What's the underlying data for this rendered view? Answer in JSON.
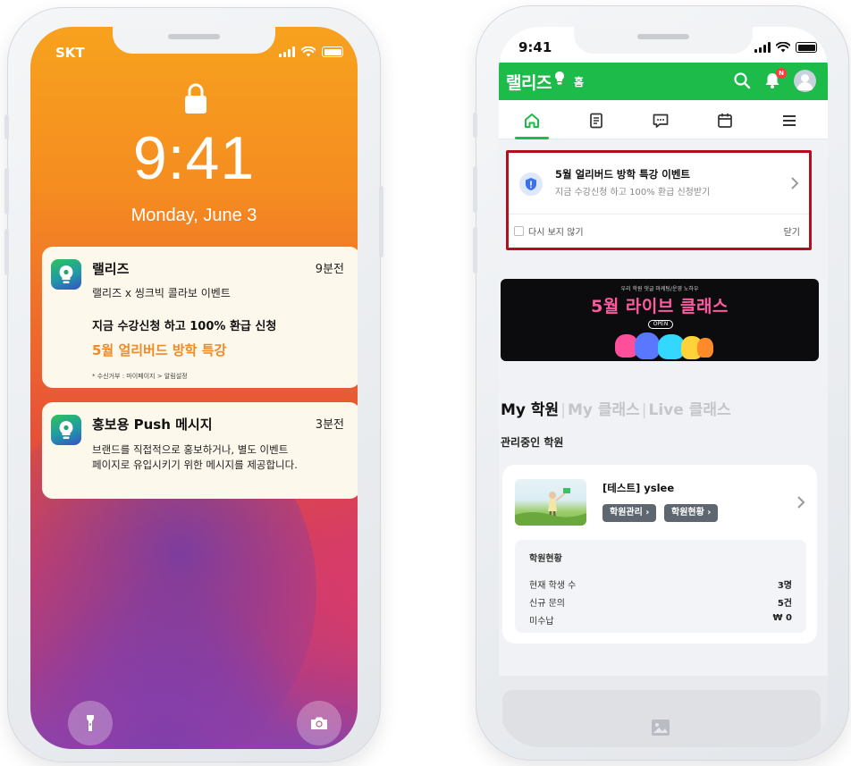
{
  "lock_screen": {
    "carrier": "SKT",
    "time": "9:41",
    "date": "Monday, June 3",
    "notifications": [
      {
        "app": "랠리즈",
        "time": "9분전",
        "subtitle": "랠리즈 x 씽크빅 콜라보 이벤트",
        "headline": "지금 수강신청 하고 100% 환급 신청",
        "highlight": "5월 얼리버드 방학 특강",
        "footnote": "* 수신거부 : 마이페이지 > 알림설정"
      },
      {
        "app": "홍보용 Push 메시지",
        "time": "3분전",
        "body_line1": "브랜드를 직접적으로 홍보하거나, 별도 이벤트",
        "body_line2": "페이지로 유입시키기 위한 메시지를 제공합니다."
      }
    ],
    "icons": [
      "lock-icon",
      "flashlight-icon",
      "camera-icon",
      "signal-icon",
      "wifi-icon",
      "battery-icon"
    ]
  },
  "app_screen": {
    "status_time": "9:41",
    "brand": "랠리즈",
    "page": "홈",
    "notification_badge": "N",
    "brand_color": "#1dbb4a",
    "tabs": [
      "home-icon",
      "document-icon",
      "chat-icon",
      "calendar-icon",
      "menu-icon"
    ],
    "event": {
      "title": "5월 얼리버드 방학 특강 이벤트",
      "subtitle": "지금 수강신청 하고 100% 환급 신청받기",
      "dont_show": "다시 보지 않기",
      "close": "닫기"
    },
    "banner": {
      "top_text": "우리 학원 댓글 마케팅/운영 노하우",
      "title": "5월 라이브 클래스",
      "badge": "OPEN"
    },
    "section_tabs": [
      "My 학원",
      "My 클래스",
      "Live 클래스"
    ],
    "managed_label": "관리중인 학원",
    "academy": {
      "name": "[테스트] yslee",
      "buttons": [
        "학원관리",
        "학원현황"
      ],
      "stats_title": "학원현황",
      "stats": [
        {
          "label": "현재 학생 수",
          "value": "3명"
        },
        {
          "label": "신규 문의",
          "value": "5건"
        },
        {
          "label": "미수납",
          "value": "₩ 0"
        }
      ]
    }
  }
}
